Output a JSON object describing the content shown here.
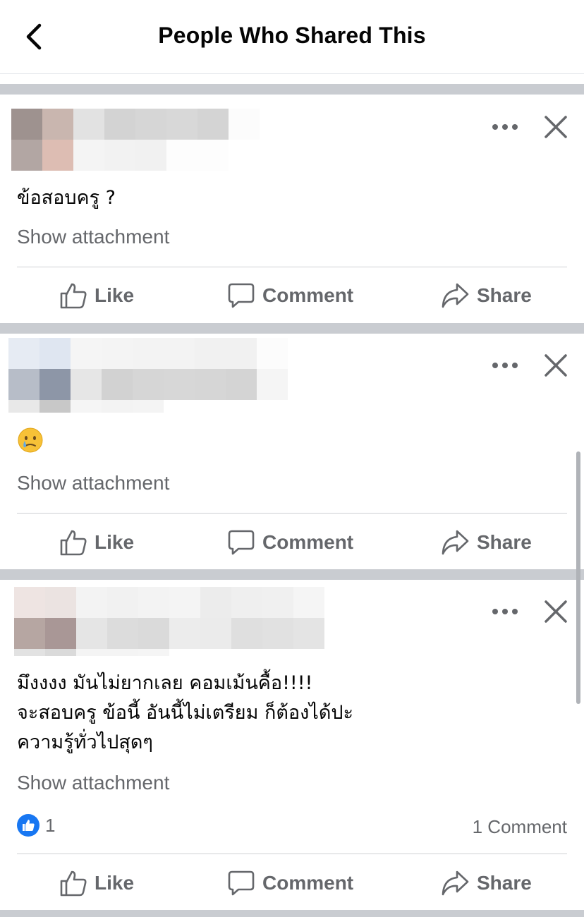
{
  "header": {
    "title": "People Who Shared This",
    "back_icon": "chevron-left-icon"
  },
  "colors": {
    "text_secondary": "#65676b",
    "separator": "#c9ccd1",
    "like_blue": "#1877f2"
  },
  "actions": {
    "like": "Like",
    "comment": "Comment",
    "share": "Share"
  },
  "posts": [
    {
      "text": "ข้อสอบครู ?",
      "attachment_label": "Show attachment"
    },
    {
      "text": "",
      "emoji": "crying-face-emoji",
      "attachment_label": "Show attachment"
    },
    {
      "text": "มึงงงง  มันไม่ยากเลย  คอมเม้นคื้อ!!!!\nจะสอบครู ข้อนี้ อันนี้ไม่เตรียม ก็ต้องได้ปะ\nความรู้ทั่วไปสุดๆ",
      "attachment_label": "Show attachment",
      "reaction_count": "1",
      "comment_count": "1 Comment"
    }
  ]
}
